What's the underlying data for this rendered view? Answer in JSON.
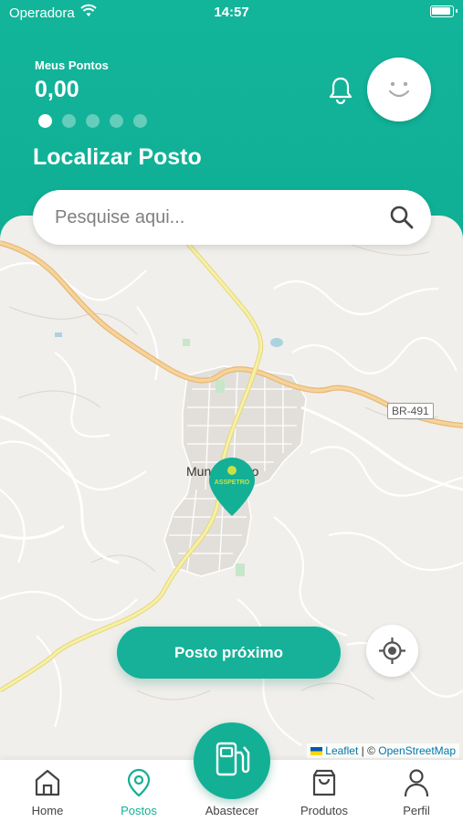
{
  "status_bar": {
    "carrier": "Operadora",
    "time": "14:57"
  },
  "header": {
    "points_label": "Meus Pontos",
    "points_value": "0,00",
    "carousel_total": 5,
    "carousel_active": 1,
    "section_title": "Localizar Posto"
  },
  "search": {
    "placeholder": "Pesquise aqui..."
  },
  "map": {
    "town_label": "Mundo Novo",
    "road_label": "BR-491",
    "pin_brand": "ASSPETRO",
    "attribution": {
      "leaflet": "Leaflet",
      "separator": " | © ",
      "osm": "OpenStreetMap"
    }
  },
  "buttons": {
    "nearby": "Posto próximo"
  },
  "tabbar": {
    "items": [
      {
        "label": "Home",
        "icon": "home-icon"
      },
      {
        "label": "Postos",
        "icon": "map-pin-icon",
        "active": true
      },
      {
        "label": "Abastecer",
        "icon": "fuel-pump-icon"
      },
      {
        "label": "Produtos",
        "icon": "shopping-bag-icon"
      },
      {
        "label": "Perfil",
        "icon": "user-icon"
      }
    ]
  },
  "colors": {
    "accent": "#14b096",
    "map_bg": "#f1efeb",
    "road_major": "#f0c27a"
  }
}
